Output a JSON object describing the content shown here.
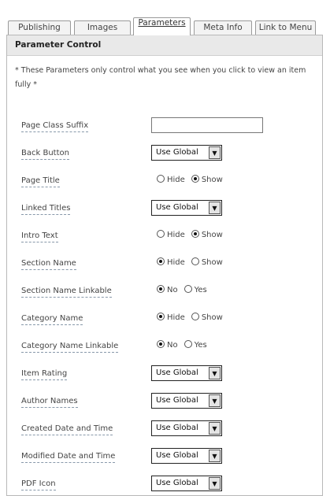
{
  "tabs": [
    "Publishing",
    "Images",
    "Parameters",
    "Meta Info",
    "Link to Menu"
  ],
  "active_tab": "Parameters",
  "panel": {
    "title": "Parameter Control",
    "note": "* These Parameters only control what you see when you click to view an item fully *"
  },
  "params": [
    {
      "label": "Page Class Suffix",
      "type": "text",
      "value": ""
    },
    {
      "label": "Back Button",
      "type": "select",
      "value": "Use Global"
    },
    {
      "label": "Page Title",
      "type": "radio",
      "options": [
        "Hide",
        "Show"
      ],
      "selected": "Show"
    },
    {
      "label": "Linked Titles",
      "type": "select",
      "value": "Use Global"
    },
    {
      "label": "Intro Text",
      "type": "radio",
      "options": [
        "Hide",
        "Show"
      ],
      "selected": "Show"
    },
    {
      "label": "Section Name",
      "type": "radio",
      "options": [
        "Hide",
        "Show"
      ],
      "selected": "Hide"
    },
    {
      "label": "Section Name Linkable",
      "type": "radio",
      "options": [
        "No",
        "Yes"
      ],
      "selected": "No"
    },
    {
      "label": "Category Name",
      "type": "radio",
      "options": [
        "Hide",
        "Show"
      ],
      "selected": "Hide"
    },
    {
      "label": "Category Name Linkable",
      "type": "radio",
      "options": [
        "No",
        "Yes"
      ],
      "selected": "No"
    },
    {
      "label": "Item Rating",
      "type": "select",
      "value": "Use Global"
    },
    {
      "label": "Author Names",
      "type": "select",
      "value": "Use Global"
    },
    {
      "label": "Created Date and Time",
      "type": "select",
      "value": "Use Global"
    },
    {
      "label": "Modified Date and Time",
      "type": "select",
      "value": "Use Global"
    },
    {
      "label": "PDF Icon",
      "type": "select",
      "value": "Use Global"
    }
  ]
}
